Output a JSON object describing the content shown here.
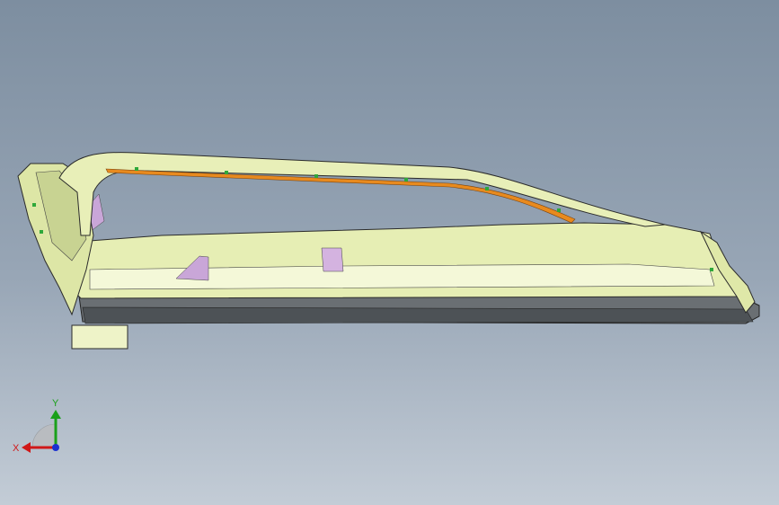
{
  "viewport": {
    "background_top": "#7d8ea0",
    "background_bottom": "#c3ccd6"
  },
  "model": {
    "description_icon": "door-frame-cad-model-icon",
    "colors": {
      "body": "#e8efb8",
      "body_shade": "#cdd79a",
      "edge": "#2b2b2b",
      "trim_orange": "#e88a1e",
      "accent_purple": "#c9a6d8",
      "base_dark": "#5a5f63",
      "clip_green": "#2fa83a"
    }
  },
  "triad": {
    "x_label": "X",
    "y_label": "Y",
    "x_color": "#d01818",
    "y_color": "#1aa01a",
    "z_color": "#1a30d0"
  }
}
